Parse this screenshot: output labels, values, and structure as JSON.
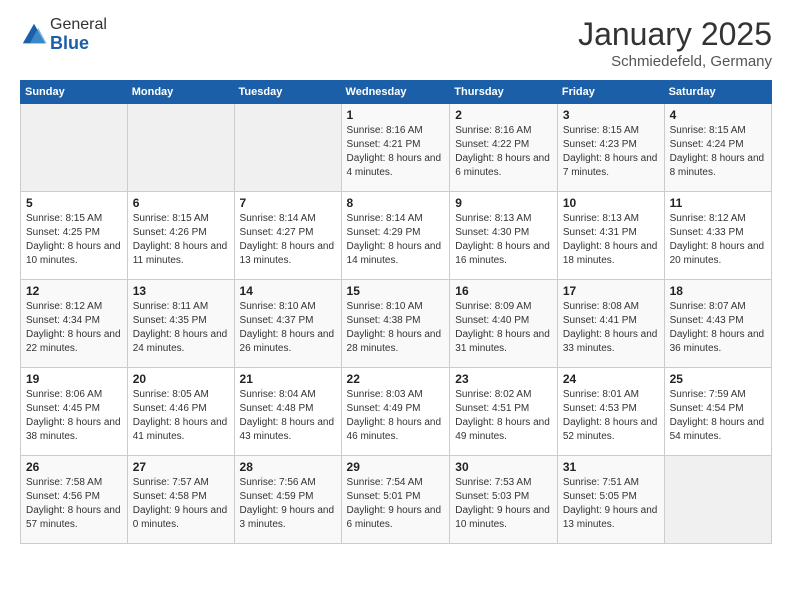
{
  "header": {
    "logo_general": "General",
    "logo_blue": "Blue",
    "month_title": "January 2025",
    "subtitle": "Schmiedefeld, Germany"
  },
  "days_of_week": [
    "Sunday",
    "Monday",
    "Tuesday",
    "Wednesday",
    "Thursday",
    "Friday",
    "Saturday"
  ],
  "weeks": [
    [
      {
        "day": "",
        "info": ""
      },
      {
        "day": "",
        "info": ""
      },
      {
        "day": "",
        "info": ""
      },
      {
        "day": "1",
        "info": "Sunrise: 8:16 AM\nSunset: 4:21 PM\nDaylight: 8 hours and 4 minutes."
      },
      {
        "day": "2",
        "info": "Sunrise: 8:16 AM\nSunset: 4:22 PM\nDaylight: 8 hours and 6 minutes."
      },
      {
        "day": "3",
        "info": "Sunrise: 8:15 AM\nSunset: 4:23 PM\nDaylight: 8 hours and 7 minutes."
      },
      {
        "day": "4",
        "info": "Sunrise: 8:15 AM\nSunset: 4:24 PM\nDaylight: 8 hours and 8 minutes."
      }
    ],
    [
      {
        "day": "5",
        "info": "Sunrise: 8:15 AM\nSunset: 4:25 PM\nDaylight: 8 hours and 10 minutes."
      },
      {
        "day": "6",
        "info": "Sunrise: 8:15 AM\nSunset: 4:26 PM\nDaylight: 8 hours and 11 minutes."
      },
      {
        "day": "7",
        "info": "Sunrise: 8:14 AM\nSunset: 4:27 PM\nDaylight: 8 hours and 13 minutes."
      },
      {
        "day": "8",
        "info": "Sunrise: 8:14 AM\nSunset: 4:29 PM\nDaylight: 8 hours and 14 minutes."
      },
      {
        "day": "9",
        "info": "Sunrise: 8:13 AM\nSunset: 4:30 PM\nDaylight: 8 hours and 16 minutes."
      },
      {
        "day": "10",
        "info": "Sunrise: 8:13 AM\nSunset: 4:31 PM\nDaylight: 8 hours and 18 minutes."
      },
      {
        "day": "11",
        "info": "Sunrise: 8:12 AM\nSunset: 4:33 PM\nDaylight: 8 hours and 20 minutes."
      }
    ],
    [
      {
        "day": "12",
        "info": "Sunrise: 8:12 AM\nSunset: 4:34 PM\nDaylight: 8 hours and 22 minutes."
      },
      {
        "day": "13",
        "info": "Sunrise: 8:11 AM\nSunset: 4:35 PM\nDaylight: 8 hours and 24 minutes."
      },
      {
        "day": "14",
        "info": "Sunrise: 8:10 AM\nSunset: 4:37 PM\nDaylight: 8 hours and 26 minutes."
      },
      {
        "day": "15",
        "info": "Sunrise: 8:10 AM\nSunset: 4:38 PM\nDaylight: 8 hours and 28 minutes."
      },
      {
        "day": "16",
        "info": "Sunrise: 8:09 AM\nSunset: 4:40 PM\nDaylight: 8 hours and 31 minutes."
      },
      {
        "day": "17",
        "info": "Sunrise: 8:08 AM\nSunset: 4:41 PM\nDaylight: 8 hours and 33 minutes."
      },
      {
        "day": "18",
        "info": "Sunrise: 8:07 AM\nSunset: 4:43 PM\nDaylight: 8 hours and 36 minutes."
      }
    ],
    [
      {
        "day": "19",
        "info": "Sunrise: 8:06 AM\nSunset: 4:45 PM\nDaylight: 8 hours and 38 minutes."
      },
      {
        "day": "20",
        "info": "Sunrise: 8:05 AM\nSunset: 4:46 PM\nDaylight: 8 hours and 41 minutes."
      },
      {
        "day": "21",
        "info": "Sunrise: 8:04 AM\nSunset: 4:48 PM\nDaylight: 8 hours and 43 minutes."
      },
      {
        "day": "22",
        "info": "Sunrise: 8:03 AM\nSunset: 4:49 PM\nDaylight: 8 hours and 46 minutes."
      },
      {
        "day": "23",
        "info": "Sunrise: 8:02 AM\nSunset: 4:51 PM\nDaylight: 8 hours and 49 minutes."
      },
      {
        "day": "24",
        "info": "Sunrise: 8:01 AM\nSunset: 4:53 PM\nDaylight: 8 hours and 52 minutes."
      },
      {
        "day": "25",
        "info": "Sunrise: 7:59 AM\nSunset: 4:54 PM\nDaylight: 8 hours and 54 minutes."
      }
    ],
    [
      {
        "day": "26",
        "info": "Sunrise: 7:58 AM\nSunset: 4:56 PM\nDaylight: 8 hours and 57 minutes."
      },
      {
        "day": "27",
        "info": "Sunrise: 7:57 AM\nSunset: 4:58 PM\nDaylight: 9 hours and 0 minutes."
      },
      {
        "day": "28",
        "info": "Sunrise: 7:56 AM\nSunset: 4:59 PM\nDaylight: 9 hours and 3 minutes."
      },
      {
        "day": "29",
        "info": "Sunrise: 7:54 AM\nSunset: 5:01 PM\nDaylight: 9 hours and 6 minutes."
      },
      {
        "day": "30",
        "info": "Sunrise: 7:53 AM\nSunset: 5:03 PM\nDaylight: 9 hours and 10 minutes."
      },
      {
        "day": "31",
        "info": "Sunrise: 7:51 AM\nSunset: 5:05 PM\nDaylight: 9 hours and 13 minutes."
      },
      {
        "day": "",
        "info": ""
      }
    ]
  ]
}
